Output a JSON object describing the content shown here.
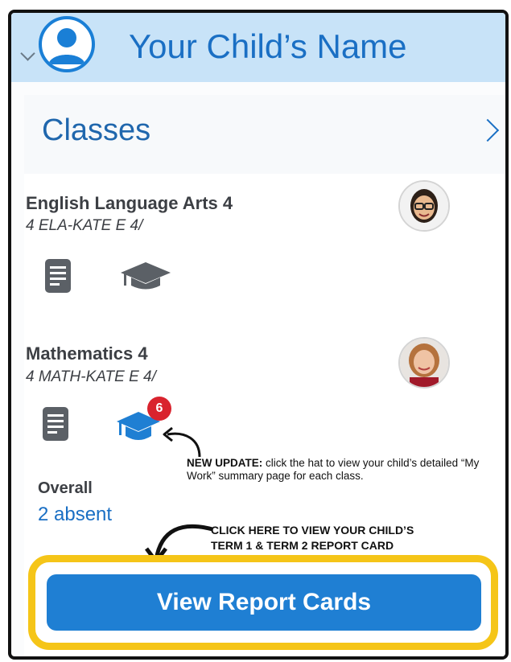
{
  "child": {
    "name": "Your Child’s Name"
  },
  "section": {
    "title": "Classes"
  },
  "classes": [
    {
      "name": "English Language Arts 4",
      "code": "4 ELA-KATE E 4/"
    },
    {
      "name": "Mathematics 4",
      "code": "4 MATH-KATE E 4/",
      "badge": "6"
    }
  ],
  "note": {
    "label": "NEW UPDATE:",
    "text": "click the hat to view your child’s detailed “My Work” summary page for each class."
  },
  "overall": {
    "label": "Overall",
    "value": "2 absent"
  },
  "cta": {
    "line1": "CLICK HERE TO VIEW YOUR CHILD’S",
    "line2": "TERM 1 & TERM 2 REPORT CARD"
  },
  "report_button": {
    "label": "View Report Cards"
  },
  "colors": {
    "header": "#c8e3f8",
    "accent": "#1a6fc4",
    "button": "#1f7fd3",
    "highlight": "#f5c518",
    "badge": "#d9232e"
  }
}
